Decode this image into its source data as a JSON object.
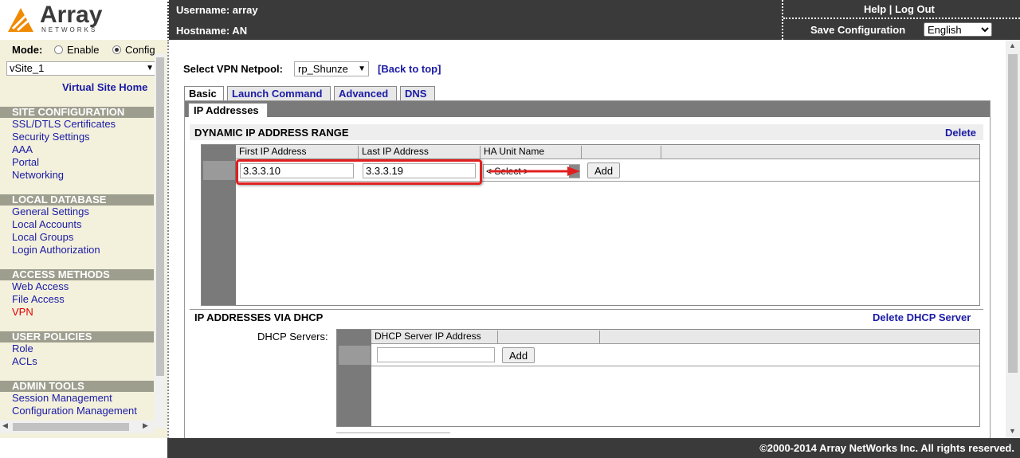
{
  "header": {
    "logo_text": "Array",
    "logo_sub": "NETWORKS",
    "username_label": "Username: array",
    "hostname_label": "Hostname: AN",
    "help": "Help",
    "separator": "|",
    "logout": "Log Out",
    "save_config": "Save Configuration",
    "language": "English"
  },
  "sidebar": {
    "mode_label": "Mode:",
    "mode_enable": "Enable",
    "mode_config": "Config",
    "site_select": "vSite_1",
    "virtual_site_home": "Virtual Site Home",
    "sections": [
      {
        "title": "SITE CONFIGURATION",
        "items": [
          "SSL/DTLS Certificates",
          "Security Settings",
          "AAA",
          "Portal",
          "Networking"
        ]
      },
      {
        "title": "LOCAL DATABASE",
        "items": [
          "General Settings",
          "Local Accounts",
          "Local Groups",
          "Login Authorization"
        ]
      },
      {
        "title": "ACCESS METHODS",
        "items": [
          "Web Access",
          "File Access",
          "VPN"
        ]
      },
      {
        "title": "USER POLICIES",
        "items": [
          "Role",
          "ACLs"
        ]
      },
      {
        "title": "ADMIN TOOLS",
        "items": [
          "Session Management",
          "Configuration Management"
        ]
      }
    ]
  },
  "main": {
    "netpool_label": "Select VPN Netpool:",
    "netpool_value": "rp_Shunze",
    "back_to_top": "[Back to top]",
    "tabs": [
      "Basic",
      "Launch Command",
      "Advanced",
      "DNS"
    ],
    "subtab": "IP Addresses",
    "dynamic_title": "DYNAMIC IP ADDRESS RANGE",
    "delete": "Delete",
    "range_table": {
      "headers": [
        "First IP Address",
        "Last IP Address",
        "HA Unit Name"
      ],
      "first_ip": "3.3.3.10",
      "last_ip": "3.3.3.19",
      "ha_select": "< Select >",
      "add": "Add"
    },
    "dhcp_title": "IP ADDRESSES VIA DHCP",
    "delete_dhcp": "Delete DHCP Server",
    "dhcp_servers_label": "DHCP Servers:",
    "dhcp_table": {
      "header": "DHCP Server IP Address",
      "value": "",
      "add": "Add"
    }
  },
  "footer": {
    "copyright": "©2000-2014 Array NetWorks Inc. All rights reserved."
  },
  "colors": {
    "header_bg": "#3a3a3a",
    "sidebar_bg": "#f3f1dc",
    "section_bg": "#9e9e8f",
    "link": "#1a1aa6",
    "active_link": "#e00000",
    "highlight": "#e02020"
  }
}
